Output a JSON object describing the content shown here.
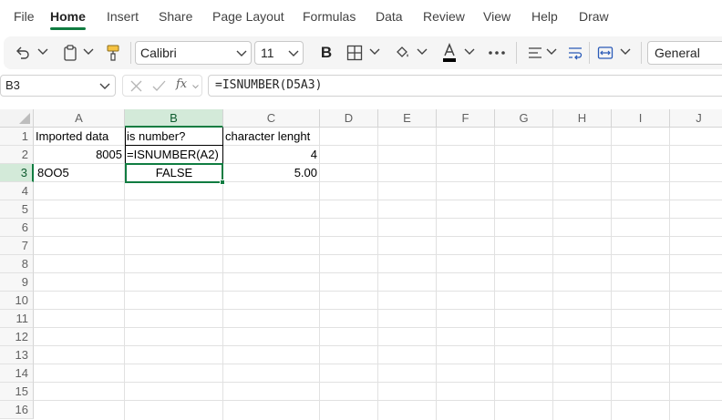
{
  "menu": {
    "items": [
      "File",
      "Home",
      "Insert",
      "Share",
      "Page Layout",
      "Formulas",
      "Data",
      "Review",
      "View",
      "Help",
      "Draw"
    ],
    "active": "Home"
  },
  "ribbon": {
    "font_name": "Calibri",
    "font_size": "11",
    "number_format": "General",
    "bold_label": "B",
    "icons": [
      "undo-icon",
      "paste-icon",
      "format-painter-icon",
      "borders-icon",
      "fill-color-icon",
      "font-color-icon",
      "more-icon",
      "align-icon",
      "wrap-text-icon",
      "merge-icon"
    ],
    "accent_color": "#107c41",
    "font_color_bar": "#000000"
  },
  "formula_bar": {
    "name_box": "B3",
    "fx_label": "fx",
    "formula": "=ISNUMBER(D5A3)"
  },
  "grid": {
    "columns": [
      "A",
      "B",
      "C",
      "D",
      "E",
      "F",
      "G",
      "H",
      "I",
      "J"
    ],
    "rows": [
      "1",
      "2",
      "3",
      "4",
      "5",
      "6",
      "7",
      "8",
      "9",
      "10",
      "11",
      "12",
      "13",
      "14",
      "15",
      "16"
    ],
    "selected_cell": "B3",
    "cells": {
      "A1": "Imported data",
      "B1": "is number?",
      "C1": "character lenght",
      "A2": "8005",
      "B2": "=ISNUMBER(A2)",
      "C2": "4",
      "A3": "8OO5",
      "B3": "FALSE",
      "C3": "5.00"
    }
  }
}
